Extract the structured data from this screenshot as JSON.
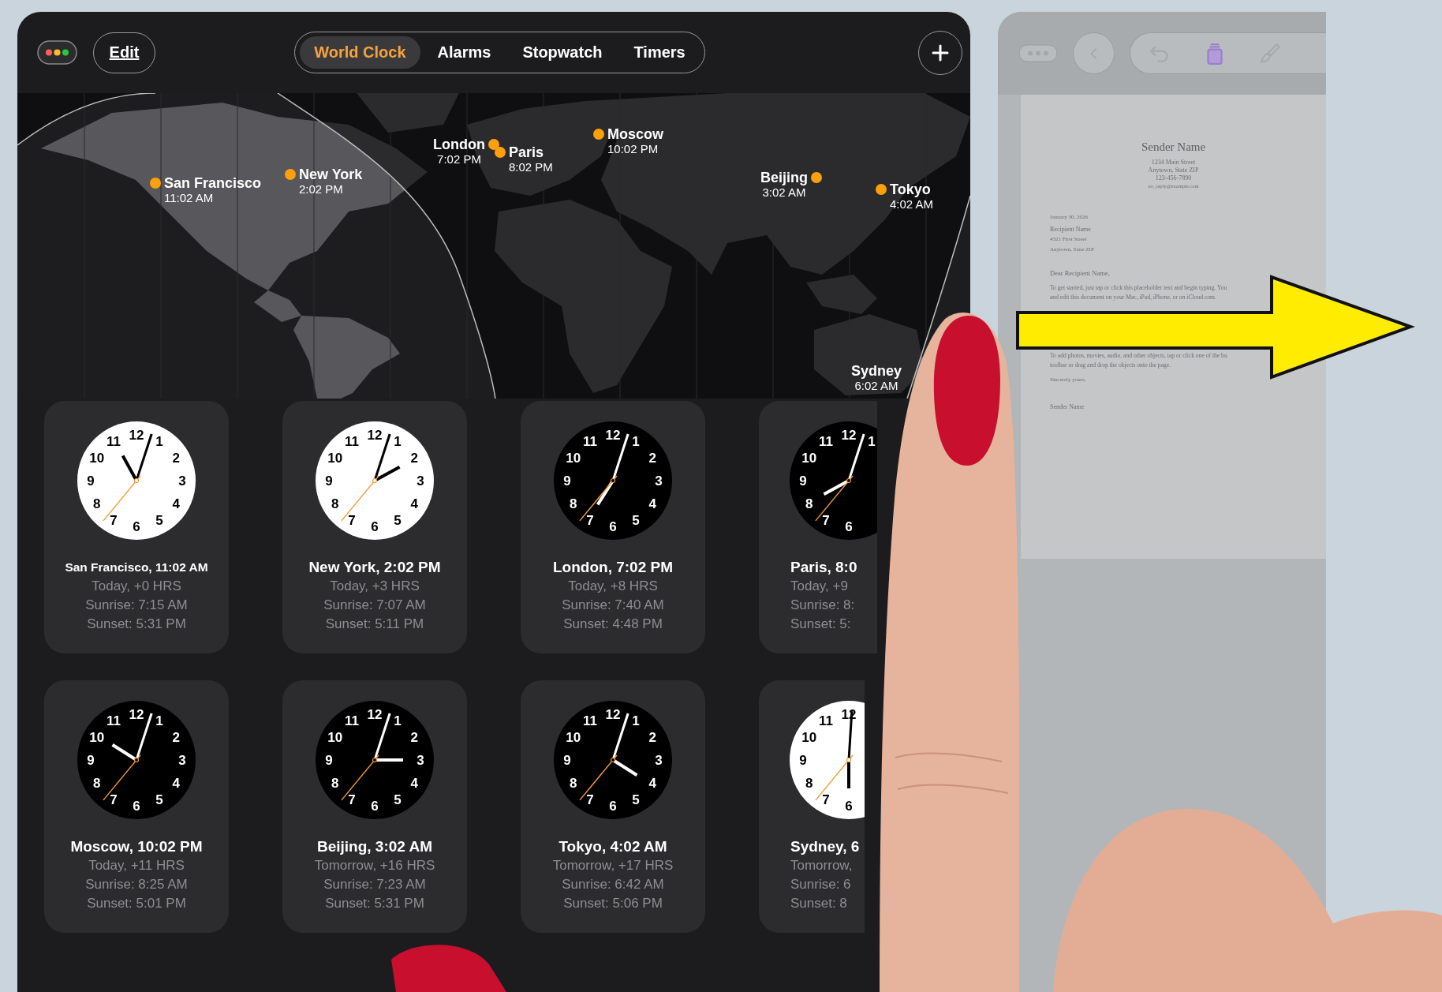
{
  "clock_app": {
    "edit_button": "Edit",
    "tabs": [
      {
        "label": "World Clock",
        "selected": true
      },
      {
        "label": "Alarms",
        "selected": false
      },
      {
        "label": "Stopwatch",
        "selected": false
      },
      {
        "label": "Timers",
        "selected": false
      }
    ],
    "map_pins": [
      {
        "city": "San Francisco",
        "time": "11:02 AM"
      },
      {
        "city": "New York",
        "time": "2:02 PM"
      },
      {
        "city": "London",
        "time": "7:02 PM"
      },
      {
        "city": "Paris",
        "time": "8:02 PM"
      },
      {
        "city": "Moscow",
        "time": "10:02 PM"
      },
      {
        "city": "Beijing",
        "time": "3:02 AM"
      },
      {
        "city": "Tokyo",
        "time": "4:02 AM"
      },
      {
        "city": "Sydney",
        "time": "6:02 AM"
      }
    ],
    "clocks": [
      {
        "kind": "light",
        "numerals": [
          "11",
          "12",
          "1",
          "10",
          "2",
          "9",
          "3",
          "8",
          "4",
          "7",
          "6",
          "5"
        ],
        "title": "San Francisco, 11:02 AM",
        "day": "Today, +0 HRS",
        "sunrise": "Sunrise: 7:15 AM",
        "sunset": "Sunset: 5:31 PM"
      },
      {
        "kind": "light",
        "numerals": [
          "11",
          "12",
          "1",
          "10",
          "2",
          "9",
          "3",
          "8",
          "4",
          "7",
          "6",
          "5"
        ],
        "title": "New York, 2:02 PM",
        "day": "Today, +3 HRS",
        "sunrise": "Sunrise: 7:07 AM",
        "sunset": "Sunset: 5:11 PM"
      },
      {
        "kind": "dark",
        "numerals": [
          "11",
          "12",
          "1",
          "10",
          "2",
          "9",
          "3",
          "8",
          "4",
          "7",
          "6",
          "5"
        ],
        "title": "London, 7:02 PM",
        "day": "Today, +8 HRS",
        "sunrise": "Sunrise: 7:40 AM",
        "sunset": "Sunset: 4:48 PM"
      },
      {
        "kind": "dark",
        "numerals": [
          "11",
          "12",
          "1",
          "10",
          "9",
          "8",
          "7",
          "6"
        ],
        "title": "Paris, 8:0",
        "day": "Today, +9",
        "sunrise": "Sunrise: 8:",
        "sunset": "Sunset: 5:"
      },
      {
        "kind": "dark",
        "numerals": [
          "11",
          "12",
          "1",
          "10",
          "2",
          "9",
          "3",
          "8",
          "4",
          "7",
          "6",
          "5"
        ],
        "title": "Moscow, 10:02 PM",
        "day": "Today, +11 HRS",
        "sunrise": "Sunrise: 8:25 AM",
        "sunset": "Sunset: 5:01 PM"
      },
      {
        "kind": "dark",
        "numerals": [
          "11",
          "12",
          "1",
          "10",
          "2",
          "9",
          "3",
          "8",
          "4",
          "7",
          "6",
          "5"
        ],
        "title": "Beijing, 3:02 AM",
        "day": "Tomorrow, +16 HRS",
        "sunrise": "Sunrise: 7:23 AM",
        "sunset": "Sunset: 5:31 PM"
      },
      {
        "kind": "dark",
        "numerals": [
          "11",
          "12",
          "1",
          "10",
          "2",
          "9",
          "3",
          "8",
          "4",
          "7",
          "6",
          "5"
        ],
        "title": "Tokyo, 4:02 AM",
        "day": "Tomorrow, +17 HRS",
        "sunrise": "Sunrise: 6:42 AM",
        "sunset": "Sunset: 5:06 PM"
      },
      {
        "kind": "light",
        "numerals": [
          "11",
          "12",
          "10",
          "9",
          "8",
          "7",
          "6"
        ],
        "title": "Sydney, 6",
        "day": "Tomorrow,",
        "sunrise": "Sunrise: 6",
        "sunset": "Sunset: 8"
      }
    ]
  },
  "document_window": {
    "letter": {
      "sender_name": "Sender Name",
      "address_lines": [
        "1234 Main Street",
        "Anytown, State ZIP",
        "123-456-7890",
        "no_reply@example.com"
      ],
      "date": "January 30, 2026",
      "recipient_lines": [
        "Recipient Name",
        "4321 First Street",
        "Anytown, State ZIP"
      ],
      "salutation": "Dear Recipient Name,",
      "paragraphs": [
        {
          "lines": [
            "To get started, just tap or click this placeholder text and begin typing. You",
            "and edit this document on your Mac, iPad, iPhone, or on iCloud.com."
          ]
        },
        {
          "lines": [
            "To add photos, movies, audio, and other objects, tap or click one of the bu",
            "toolbar or drag and drop the objects onto the page."
          ]
        }
      ],
      "closing": "Sincerely yours,",
      "signature": "Sender Name"
    }
  }
}
